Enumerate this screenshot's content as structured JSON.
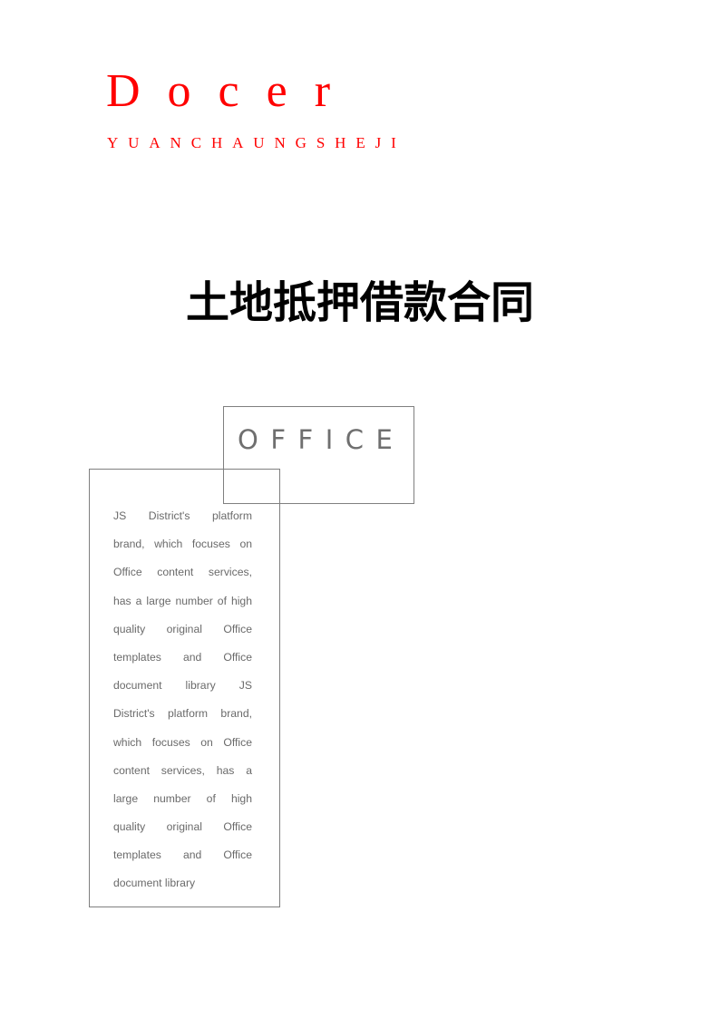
{
  "header": {
    "brand": "Docer",
    "brand_subtitle": "YUANCHAUNGSHEJI"
  },
  "document": {
    "title": "土地抵押借款合同"
  },
  "office_box": {
    "label": "OFFICE"
  },
  "description": {
    "lines": [
      "JS District's platform",
      "brand, which focuses on",
      "Office content services,",
      "has a large number of high",
      "quality original Office",
      "templates and Office",
      "document library JS",
      "District's platform brand,",
      "which focuses on Office",
      "content services, has a",
      "large number of high",
      "quality original Office",
      "templates and Office",
      "document library"
    ]
  }
}
